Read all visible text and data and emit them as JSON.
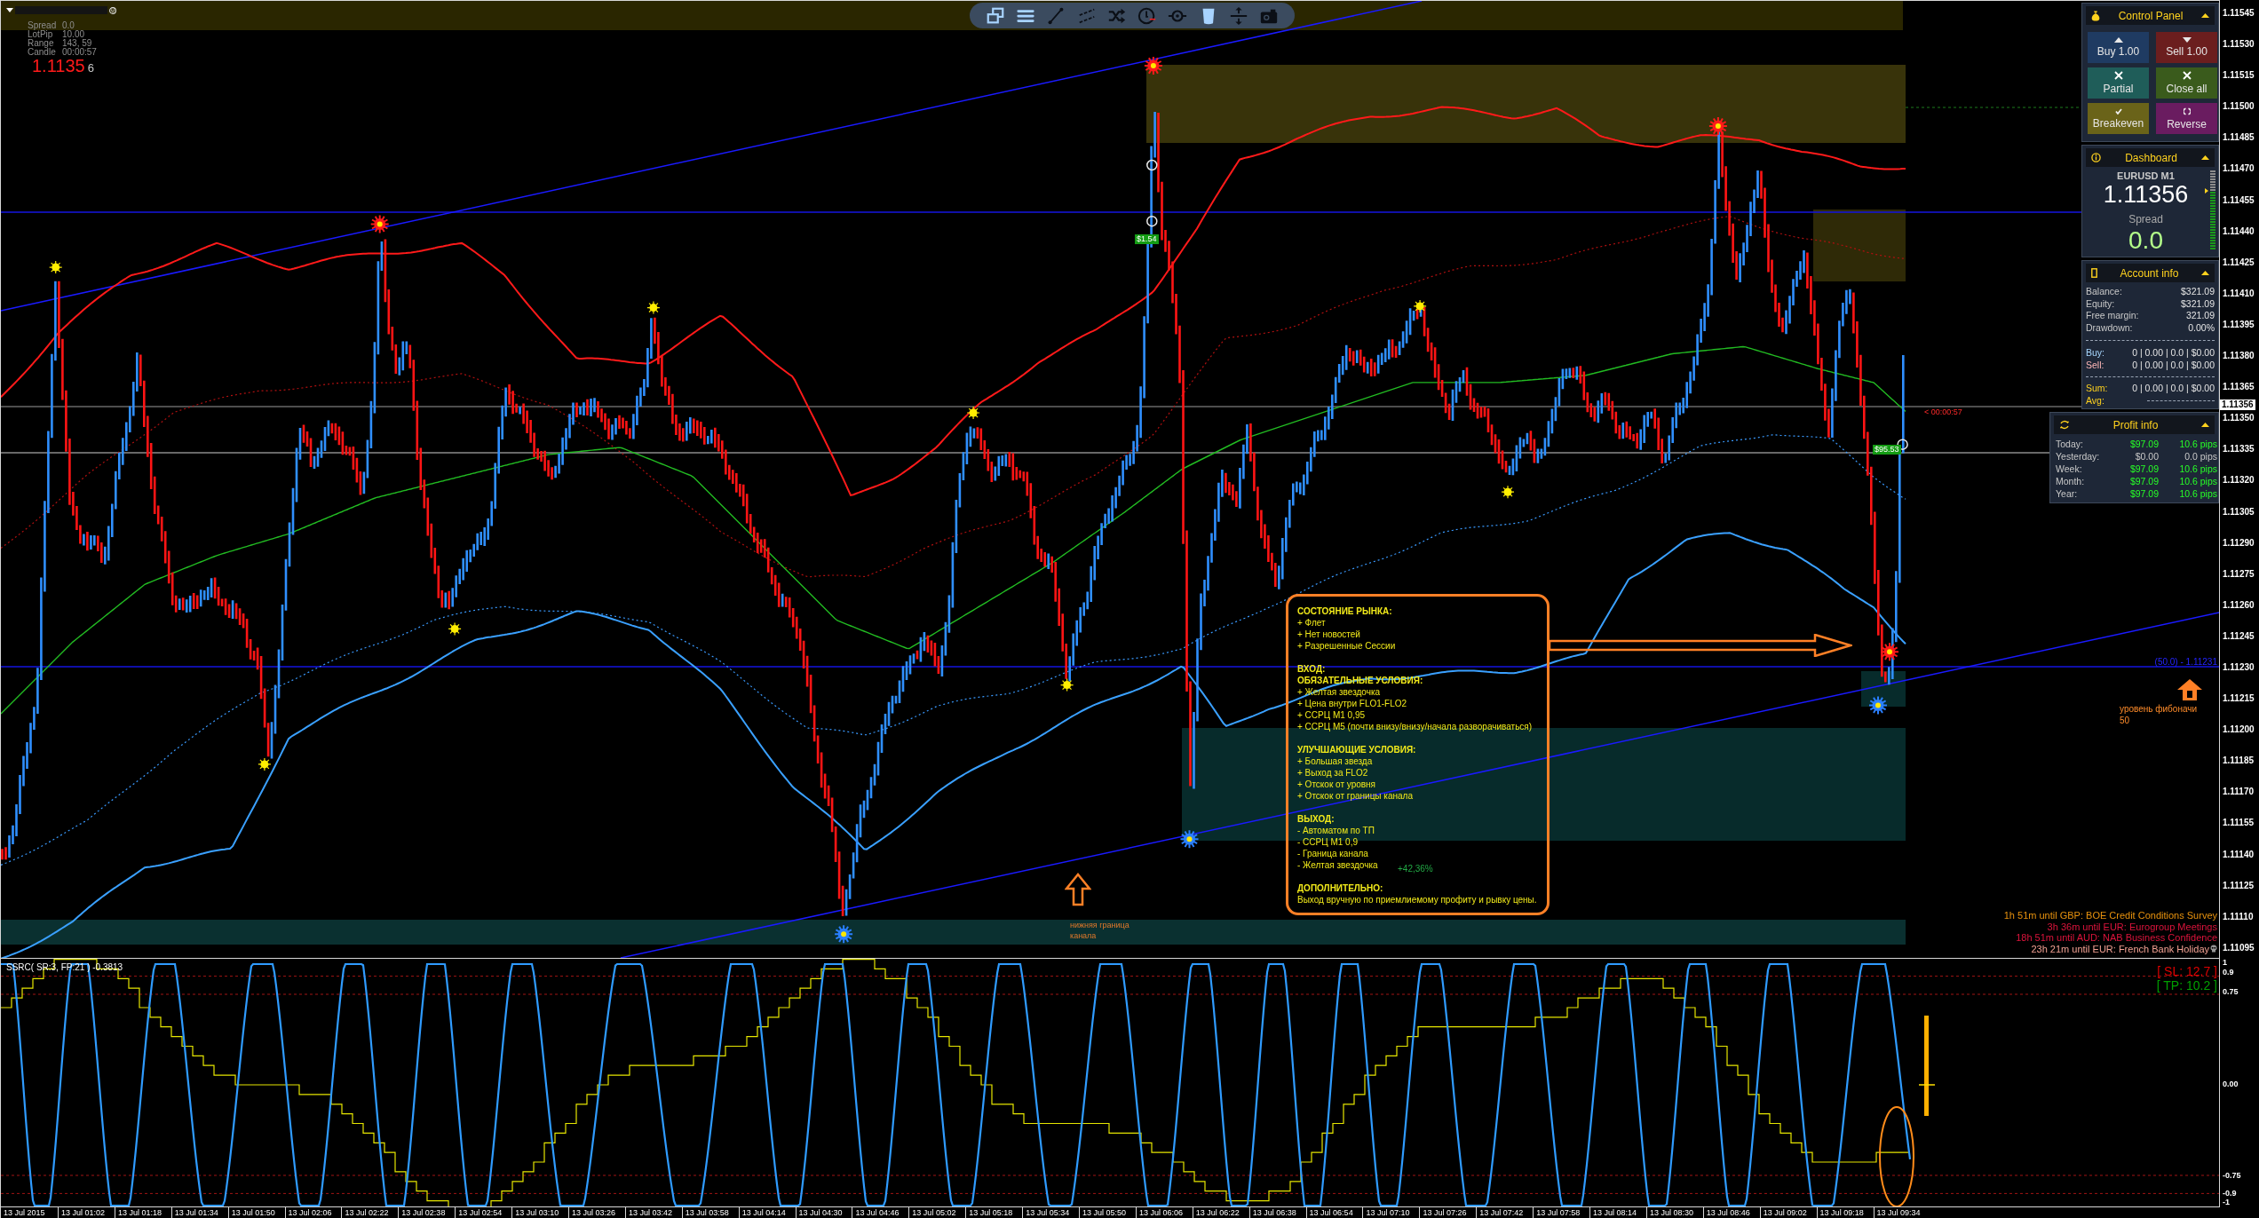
{
  "info_panel": {
    "rows": [
      {
        "label": "Spread",
        "value": "0.0"
      },
      {
        "label": "LotPip",
        "value": "10.00"
      },
      {
        "label": "Range",
        "value": "143, 59"
      },
      {
        "label": "Candle",
        "value": "00:00:57"
      }
    ],
    "price": "1.1135",
    "price_tail": "6"
  },
  "toolbar": {
    "tools": [
      {
        "kind": "windows",
        "on": true
      },
      {
        "kind": "menu",
        "on": true
      },
      {
        "kind": "line",
        "on": false
      },
      {
        "kind": "channel",
        "on": false
      },
      {
        "kind": "shuffle",
        "on": false
      },
      {
        "kind": "clock",
        "on": false
      },
      {
        "kind": "target",
        "on": false
      },
      {
        "kind": "trash",
        "on": true
      },
      {
        "kind": "resize",
        "on": false
      },
      {
        "kind": "camera",
        "on": false
      }
    ]
  },
  "notes": {
    "sections": [
      {
        "headings": [
          "СОСТОЯНИЕ РЫНКА:"
        ],
        "lines": [
          "+ Флет",
          "+ Нет новостей",
          "+ Разрешенные Сессии"
        ]
      },
      {
        "headings": [
          "ВХОД:",
          "ОБЯЗАТЕЛЬНЫЕ УСЛОВИЯ:"
        ],
        "lines": [
          "+ Желтая звездочка",
          "+ Цена внутри FLO1-FLO2",
          "+ ССРЦ M1 0,95",
          "+ ССРЦ M5 (почти внизу/внизу/начала разворачиваться)"
        ]
      },
      {
        "headings": [
          "УЛУЧШАЮЩИЕ УСЛОВИЯ:"
        ],
        "lines": [
          "+ Большая звезда",
          "+ Выход за FLO2",
          "+ Отскок от уровня",
          "+ Отскок от границы канала"
        ]
      },
      {
        "headings": [
          "ВЫХОД:"
        ],
        "lines": [
          "- Автоматом по ТП",
          "- ССРЦ M1 0,9",
          "- Граница канала",
          "- Желтая звездочка"
        ]
      },
      {
        "headings": [
          "ДОПОЛНИТЕЛЬНО:"
        ],
        "lines": [
          "Выход вручную по приемлиемому профиту и рывку цены."
        ]
      }
    ],
    "result": "+42,36%"
  },
  "chart_labels": {
    "trade_tags": [
      "$1.54",
      "$95.53"
    ],
    "countdown": "< 00:00:57",
    "fib_level": "(50.0) - 1.11231",
    "channel_note": [
      "нижняя граница",
      "канала"
    ],
    "fib_note": [
      "уровень фибоначи",
      "50"
    ]
  },
  "news": [
    {
      "text": "1h 51m until GBP: BOE Credit Conditions Survey",
      "color": "#e8920e",
      "has_icon": false
    },
    {
      "text": "3h 36m until EUR: Eurogroup Meetings",
      "color": "#dc143c",
      "has_icon": false
    },
    {
      "text": "18h 51m until AUD: NAB Business Confidence",
      "color": "#dc143c",
      "has_icon": false
    },
    {
      "text": "23h 21m until EUR: French Bank Holiday",
      "color": "#f2a193",
      "has_icon": true
    }
  ],
  "control_panel": {
    "title": "Control Panel",
    "expanded": true,
    "buttons": [
      {
        "kind": "buy",
        "label": "Buy 1.00"
      },
      {
        "kind": "sell",
        "label": "Sell 1.00"
      },
      {
        "kind": "partial",
        "label": "Partial"
      },
      {
        "kind": "close_all",
        "label": "Close all"
      },
      {
        "kind": "breakeven",
        "label": "Breakeven"
      },
      {
        "kind": "reverse",
        "label": "Reverse"
      }
    ]
  },
  "dashboard": {
    "title": "Dashboard",
    "expanded": true,
    "symbol": "EURUSD M1",
    "price": "1.11356",
    "spread_label": "Spread",
    "spread": "0.0",
    "meter": {
      "level": 0.73
    }
  },
  "account_info": {
    "title": "Account info",
    "expanded": true,
    "rows": [
      {
        "label": "Balance:",
        "value": "$321.09"
      },
      {
        "label": "Equity:",
        "value": "$321.09"
      },
      {
        "label": "Free margin:",
        "value": "321.09"
      },
      {
        "label": "Drawdown:",
        "value": "0.00%"
      }
    ],
    "positions": [
      {
        "kind": "buy",
        "label": "Buy:",
        "value": "0 | 0.00 | 0.0 | $0.00"
      },
      {
        "kind": "sell",
        "label": "Sell:",
        "value": "0 | 0.00 | 0.0 | $0.00"
      }
    ],
    "totals": [
      {
        "label": "Sum:",
        "value": "0 | 0.00 | 0.0 | $0.00"
      },
      {
        "label": "Avg:"
      }
    ]
  },
  "profit_info": {
    "title": "Profit info",
    "expanded": true,
    "rows": [
      {
        "label": "Today:",
        "amount": "$97.09",
        "pips": "10.6 pips",
        "positive": true
      },
      {
        "label": "Yesterday:",
        "amount": "$0.00",
        "pips": "0.0 pips",
        "positive": false
      },
      {
        "label": "Week:",
        "amount": "$97.09",
        "pips": "10.6 pips",
        "positive": true
      },
      {
        "label": "Month:",
        "amount": "$97.09",
        "pips": "10.6 pips",
        "positive": true
      },
      {
        "label": "Year:",
        "amount": "$97.09",
        "pips": "10.6 pips",
        "positive": true
      }
    ]
  },
  "price_axis": {
    "labels": [
      "1.11545",
      "1.11530",
      "1.11515",
      "1.11500",
      "1.11485",
      "1.11470",
      "1.11455",
      "1.11440",
      "1.11425",
      "1.11410",
      "1.11395",
      "1.11380",
      "1.11365",
      "1.11350",
      "1.11335",
      "1.11320",
      "1.11305",
      "1.11290",
      "1.11275",
      "1.11260",
      "1.11245",
      "1.11230",
      "1.11215",
      "1.11200",
      "1.11185",
      "1.11170",
      "1.11155",
      "1.11140",
      "1.11125",
      "1.11110",
      "1.11095"
    ],
    "current": "1.11356"
  },
  "indicator": {
    "title": "SSRC( SR:3, FP:21 ) -0.3813",
    "stop_loss": "[ SL: 12.7 ]",
    "take_profit": "[ TP: 10.2 ]",
    "axis_labels": [
      "1",
      "0.9",
      "0.75",
      "0.00",
      "-0.75",
      "-0.9",
      "-1"
    ]
  },
  "time_axis": {
    "labels": [
      "13 Jul 2015",
      "13 Jul 01:02",
      "13 Jul 01:18",
      "13 Jul 01:34",
      "13 Jul 01:50",
      "13 Jul 02:06",
      "13 Jul 02:22",
      "13 Jul 02:38",
      "13 Jul 02:54",
      "13 Jul 03:10",
      "13 Jul 03:26",
      "13 Jul 03:42",
      "13 Jul 03:58",
      "13 Jul 04:14",
      "13 Jul 04:30",
      "13 Jul 04:46",
      "13 Jul 05:02",
      "13 Jul 05:18",
      "13 Jul 05:34",
      "13 Jul 05:50",
      "13 Jul 06:06",
      "13 Jul 06:22",
      "13 Jul 06:38",
      "13 Jul 06:54",
      "13 Jul 07:10",
      "13 Jul 07:26",
      "13 Jul 07:42",
      "13 Jul 07:58",
      "13 Jul 08:14",
      "13 Jul 08:30",
      "13 Jul 08:46",
      "13 Jul 09:02",
      "13 Jul 09:18",
      "13 Jul 09:34"
    ]
  }
}
